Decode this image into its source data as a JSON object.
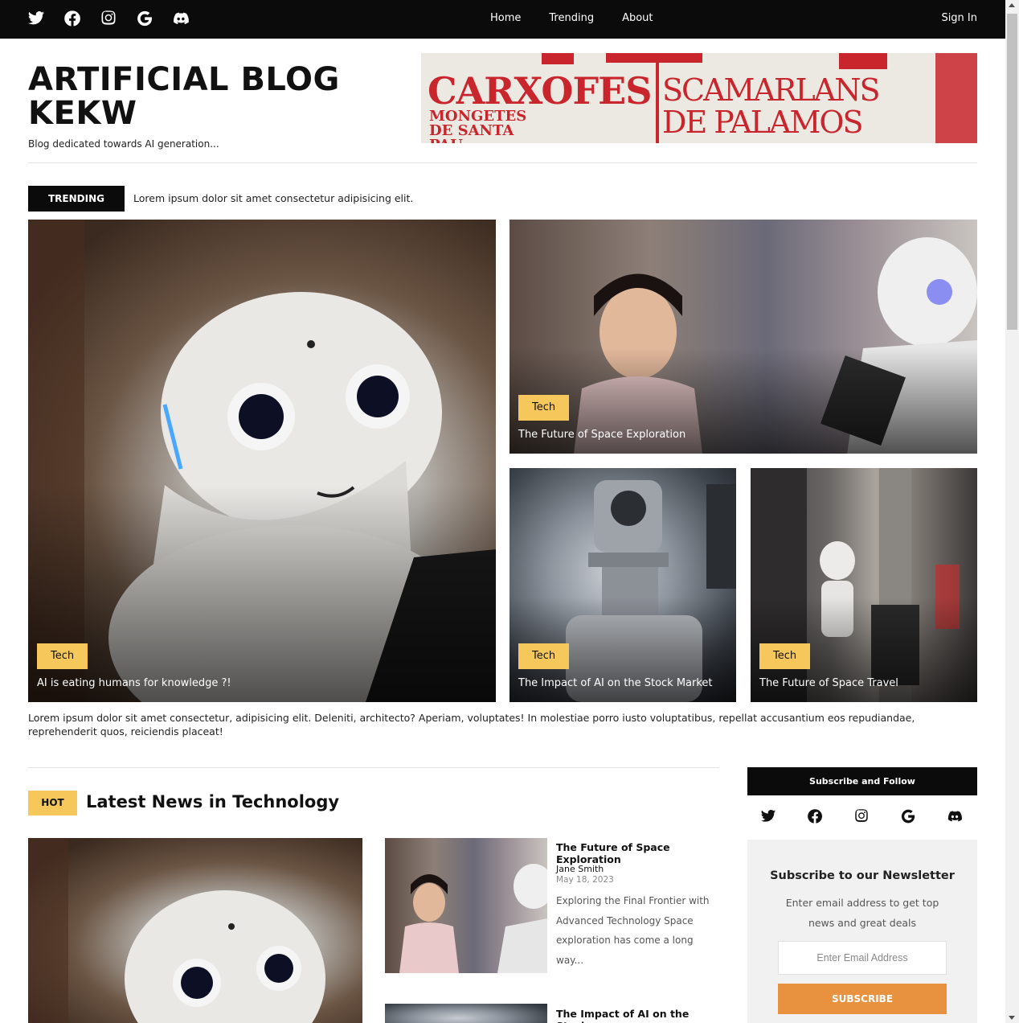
{
  "nav": {
    "social_icons": [
      "twitter-icon",
      "facebook-icon",
      "instagram-icon",
      "google-icon",
      "discord-icon"
    ],
    "menu": [
      "Home",
      "Trending",
      "About"
    ],
    "sign_in": "Sign In"
  },
  "header": {
    "title": "ARTIFICIAL BLOG KEKW",
    "subtitle": "Blog dedicated towards AI generation...",
    "banner_text": [
      "CARXOFES",
      "SCAMARLANS",
      "MONGETES DE SANTA PAU",
      "DE PALAMOS"
    ]
  },
  "trending": {
    "label": "TRENDING",
    "text": "Lorem ipsum dolor sit amet consectetur adipisicing elit."
  },
  "hero": [
    {
      "tag": "Tech",
      "caption": "AI is eating humans for knowledge ?!"
    },
    {
      "tag": "Tech",
      "caption": "The Future of Space Exploration"
    },
    {
      "tag": "Tech",
      "caption": "The Impact of AI on the Stock Market"
    },
    {
      "tag": "Tech",
      "caption": "The Future of Space Travel"
    }
  ],
  "intro": "Lorem ipsum dolor sit amet consectetur, adipisicing elit. Deleniti, architecto? Aperiam, voluptates! In molestiae porro iusto voluptatibus, repellat accusantium eos repudiandae, reprehenderit quos, reiciendis placeat!",
  "latest": {
    "badge": "HOT",
    "title": "Latest News in Technology",
    "articles": [
      {
        "title": "The Future of Space Exploration",
        "author": "Jane Smith",
        "date": "May 18, 2023",
        "excerpt": "Exploring the Final Frontier with Advanced Technology Space exploration has come a long way..."
      },
      {
        "title": "The Impact of AI on the Stock"
      }
    ]
  },
  "sidebar": {
    "follow_title": "Subscribe and Follow",
    "icons": [
      "twitter-icon",
      "facebook-icon",
      "instagram-icon",
      "google-icon",
      "discord-icon"
    ],
    "newsletter_title": "Subscribe to our Newsletter",
    "newsletter_desc": "Enter email address to get top news and great deals",
    "email_placeholder": "Enter Email Address",
    "subscribe_label": "SUBSCRIBE"
  },
  "colors": {
    "nav_bg": "#0b0b0b",
    "tag_yellow": "#f6c75a",
    "subscribe_orange": "#e8923f",
    "newsletter_bg": "#f1f1f1"
  }
}
